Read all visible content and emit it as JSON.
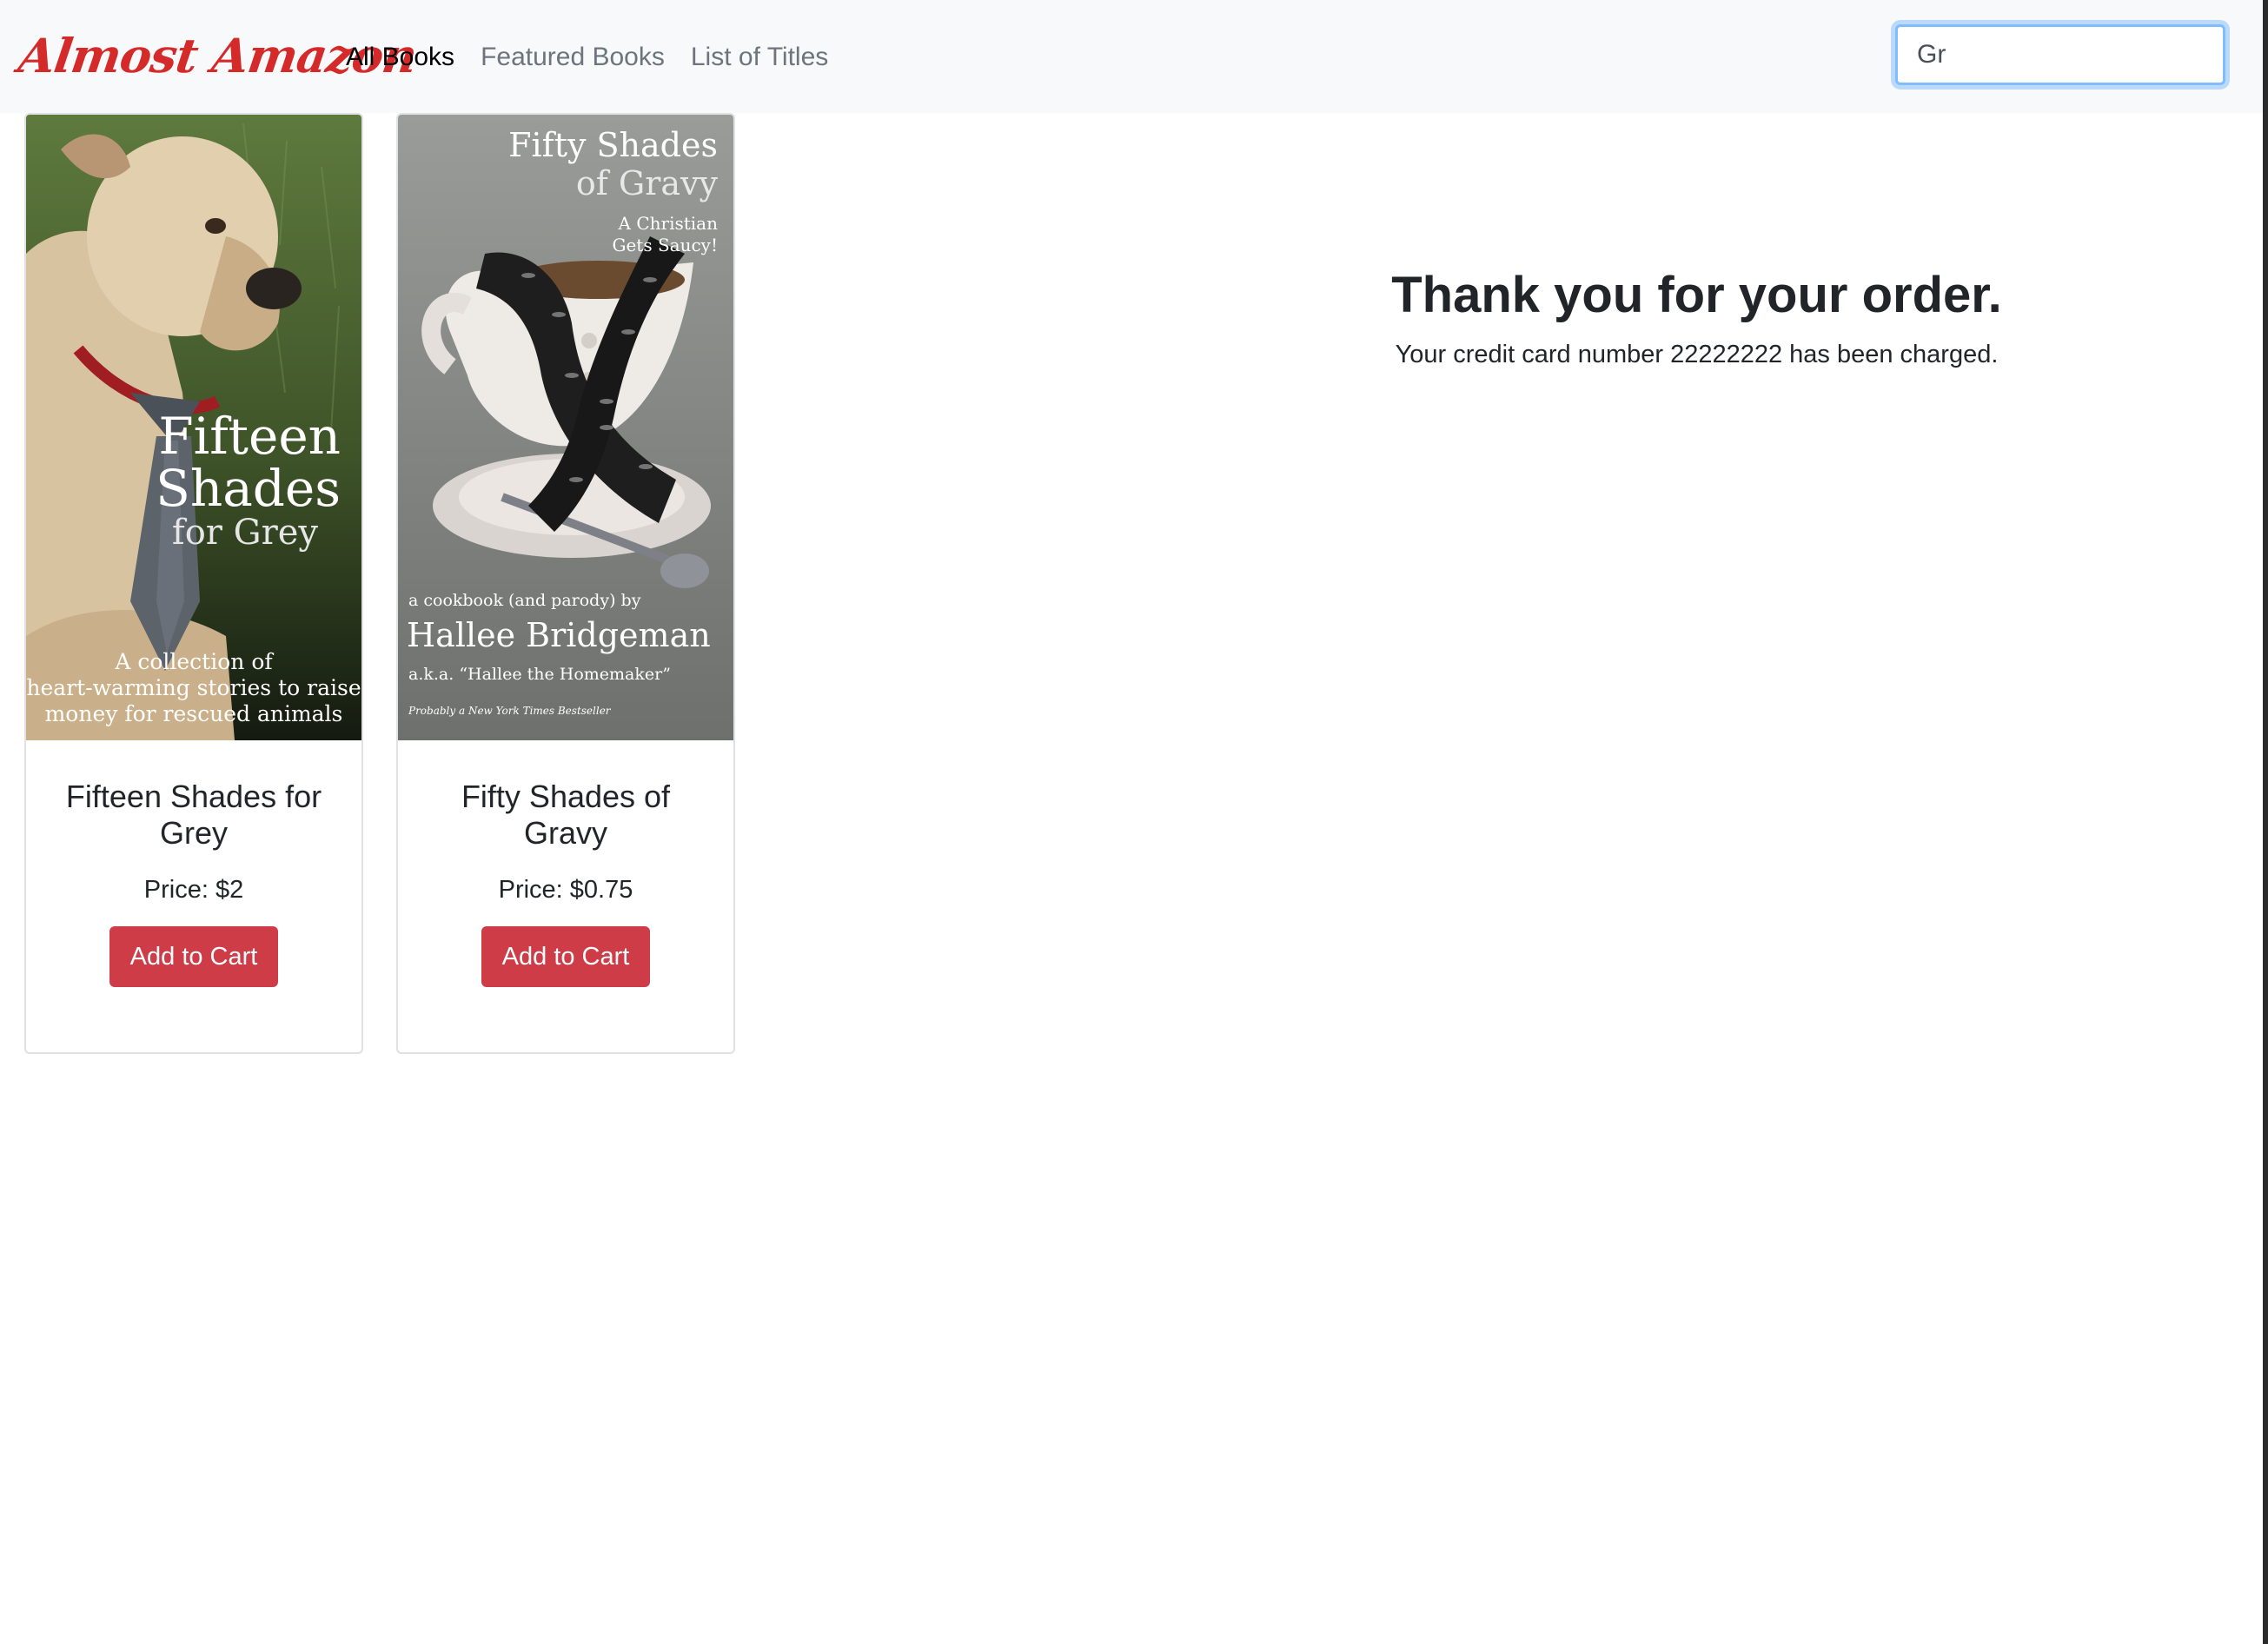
{
  "navbar": {
    "brand": "Almost Amazon",
    "links": [
      {
        "label": "All Books",
        "active": true
      },
      {
        "label": "Featured Books",
        "active": false
      },
      {
        "label": "List of Titles",
        "active": false
      }
    ],
    "search_value": "Gr"
  },
  "books": [
    {
      "title": "Fifteen Shades for Grey",
      "price": "Price: $2",
      "button": "Add to Cart",
      "cover": {
        "icon": "dog-in-necktie-cover",
        "title_line1": "Fifteen",
        "title_line2": "Shades",
        "title_line3": "for Grey",
        "tagline_line1": "A collection of",
        "tagline_line2": "heart-warming stories to raise",
        "tagline_line3": "money for rescued animals"
      }
    },
    {
      "title": "Fifty Shades of Gravy",
      "price": "Price: $0.75",
      "button": "Add to Cart",
      "cover": {
        "icon": "gravy-boat-cover",
        "title_line1": "Fifty Shades",
        "title_line2": "of Gravy",
        "subtitle_line1": "A Christian",
        "subtitle_line2": "Gets Saucy!",
        "byline": "a cookbook (and parody) by",
        "author": "Hallee Bridgeman",
        "aka": "a.k.a. “Hallee the Homemaker”",
        "footer": "Probably a New York Times Bestseller"
      }
    }
  ],
  "confirmation": {
    "heading": "Thank you for your order.",
    "message": "Your credit card number 22222222 has been charged."
  },
  "colors": {
    "brand": "#d52a2a",
    "button": "#cd3c47",
    "navbar_bg": "#f8f9fa",
    "nav_active": "#000000",
    "nav_inactive": "#6c757d"
  }
}
